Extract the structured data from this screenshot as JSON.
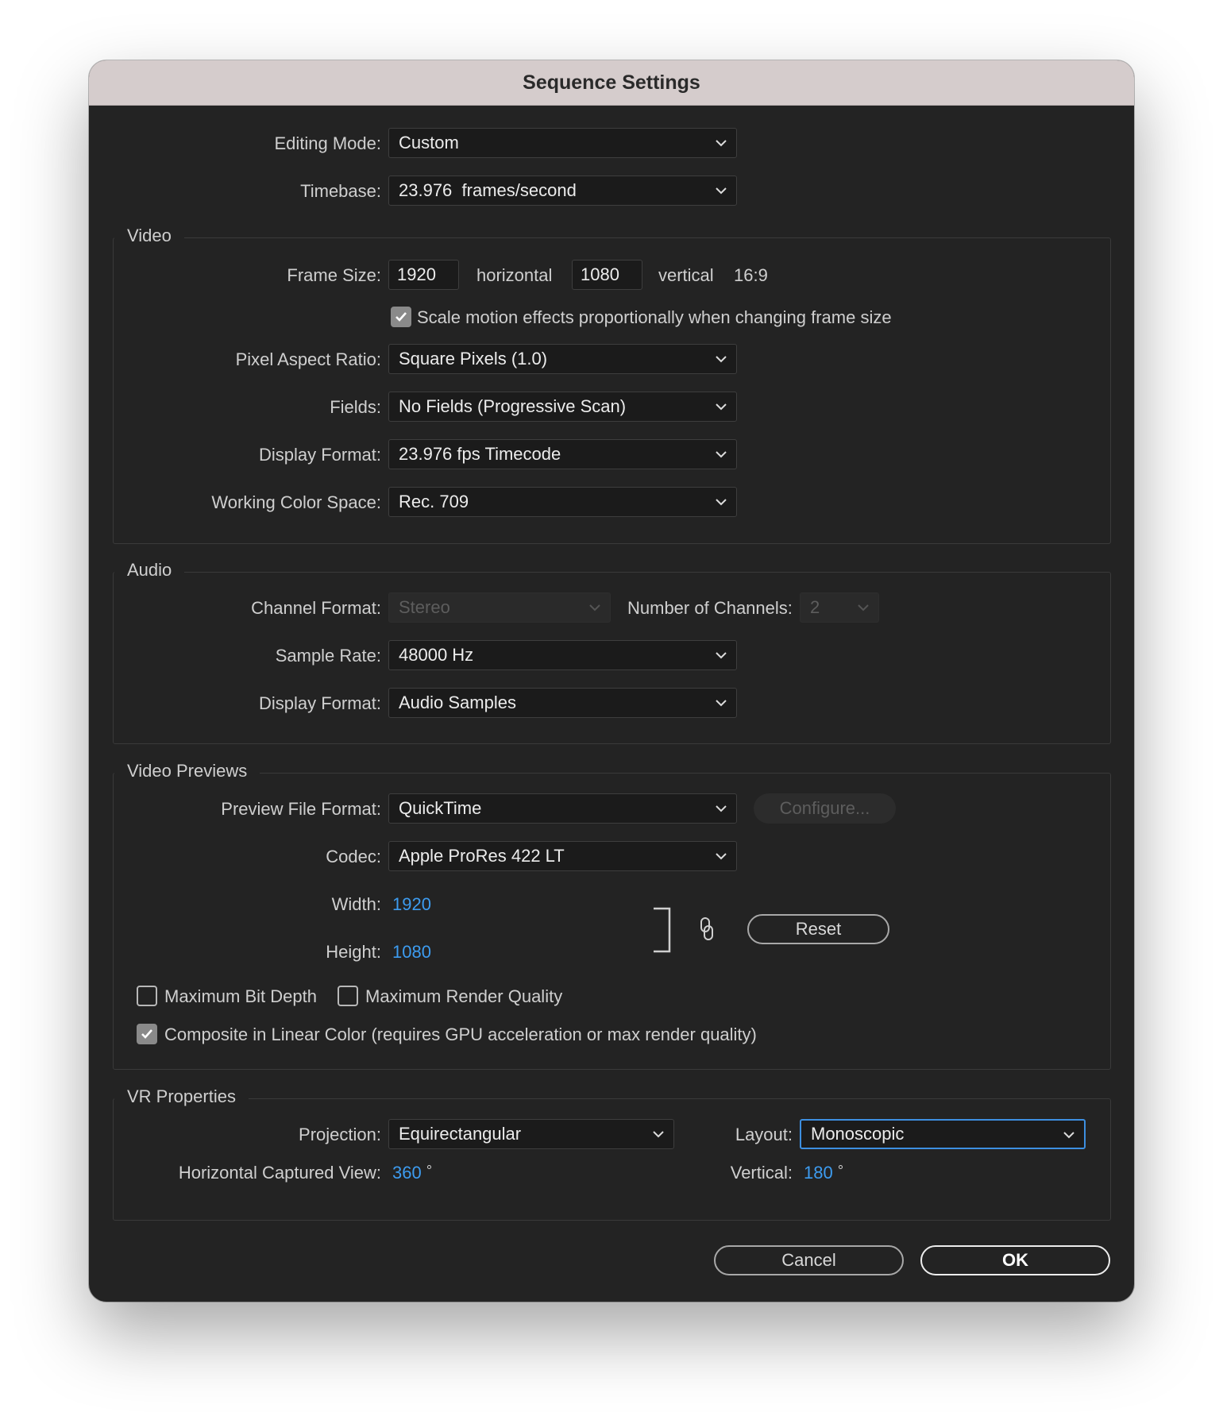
{
  "window": {
    "title": "Sequence Settings"
  },
  "top": {
    "editing_mode_label": "Editing Mode:",
    "editing_mode_value": "Custom",
    "timebase_label": "Timebase:",
    "timebase_value": "23.976  frames/second"
  },
  "video": {
    "title": "Video",
    "frame_size_label": "Frame Size:",
    "width_value": "1920",
    "horizontal_label": "horizontal",
    "height_value": "1080",
    "vertical_label": "vertical",
    "aspect": "16:9",
    "scale_motion_label": "Scale motion effects proportionally when changing frame size",
    "scale_motion_checked": true,
    "par_label": "Pixel Aspect Ratio:",
    "par_value": "Square Pixels (1.0)",
    "fields_label": "Fields:",
    "fields_value": "No Fields (Progressive Scan)",
    "display_format_label": "Display Format:",
    "display_format_value": "23.976 fps Timecode",
    "color_space_label": "Working Color Space:",
    "color_space_value": "Rec. 709"
  },
  "audio": {
    "title": "Audio",
    "channel_format_label": "Channel Format:",
    "channel_format_value": "Stereo",
    "num_channels_label": "Number of Channels:",
    "num_channels_value": "2",
    "sample_rate_label": "Sample Rate:",
    "sample_rate_value": "48000 Hz",
    "display_format_label": "Display Format:",
    "display_format_value": "Audio Samples"
  },
  "previews": {
    "title": "Video Previews",
    "file_format_label": "Preview File Format:",
    "file_format_value": "QuickTime",
    "configure_label": "Configure...",
    "codec_label": "Codec:",
    "codec_value": "Apple ProRes 422 LT",
    "width_label": "Width:",
    "width_value": "1920",
    "height_label": "Height:",
    "height_value": "1080",
    "reset_label": "Reset",
    "max_bit_depth_label": "Maximum Bit Depth",
    "max_bit_depth_checked": false,
    "max_render_quality_label": "Maximum Render Quality",
    "max_render_quality_checked": false,
    "linear_color_label": "Composite in Linear Color (requires GPU acceleration or max render quality)",
    "linear_color_checked": true
  },
  "vr": {
    "title": "VR Properties",
    "projection_label": "Projection:",
    "projection_value": "Equirectangular",
    "layout_label": "Layout:",
    "layout_value": "Monoscopic",
    "hcv_label": "Horizontal Captured View:",
    "hcv_value": "360",
    "vertical_label": "Vertical:",
    "vertical_value": "180",
    "degree": "°"
  },
  "buttons": {
    "cancel": "Cancel",
    "ok": "OK"
  },
  "colors": {
    "accent": "#3d9cf0",
    "focus": "#3d8fe0",
    "background": "#232323",
    "titlebar": "#d5cccc"
  },
  "icons": [
    "chevron-down-icon",
    "checkmark-icon",
    "link-chain-icon",
    "bracket-icon"
  ]
}
